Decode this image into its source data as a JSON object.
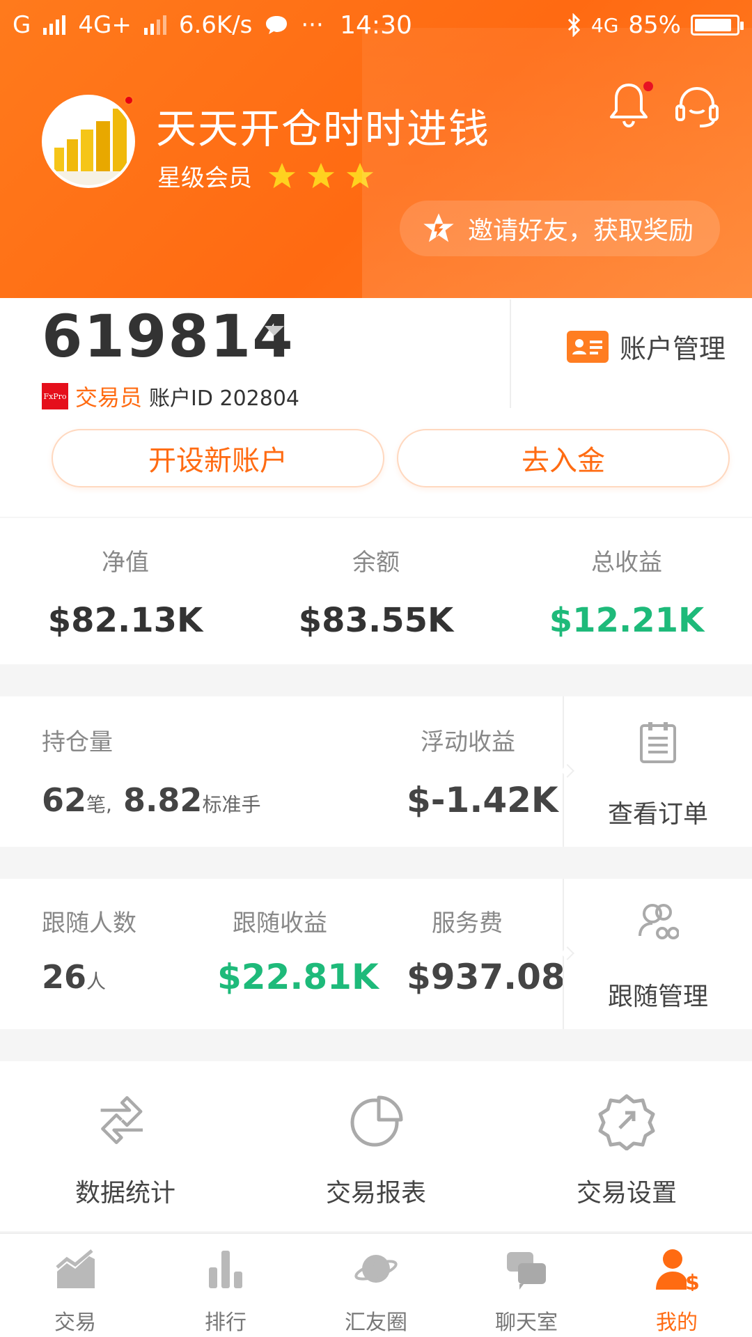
{
  "status_bar": {
    "carrier": "G",
    "network": "4G+",
    "speed": "6.6K/s",
    "time": "14:30",
    "network2": "4G",
    "battery": "85%"
  },
  "profile": {
    "nickname": "天天开仓时时进钱",
    "member_level": "星级会员",
    "stars": 3,
    "invite_text": "邀请好友，获取奖励"
  },
  "account": {
    "number": "619814",
    "broker_logo": "FxPro",
    "role": "交易员",
    "id_label": "账户ID 202804",
    "manage_label": "账户管理",
    "open_new_label": "开设新账户",
    "deposit_label": "去入金"
  },
  "stats": [
    {
      "label": "净值",
      "value": "$82.13K"
    },
    {
      "label": "余额",
      "value": "$83.55K"
    },
    {
      "label": "总收益",
      "value": "$12.21K"
    }
  ],
  "positions": {
    "holding_label": "持仓量",
    "holding_count": "62",
    "holding_count_unit": "笔,",
    "holding_lots": "8.82",
    "holding_lots_unit": "标准手",
    "floating_label": "浮动收益",
    "floating_value": "$-1.42K",
    "view_orders_label": "查看订单"
  },
  "follow": {
    "followers_label": "跟随人数",
    "followers_value": "26",
    "followers_unit": "人",
    "follow_profit_label": "跟随收益",
    "follow_profit_value": "$22.81K",
    "service_fee_label": "服务费",
    "service_fee_value": "$937.08",
    "manage_label": "跟随管理"
  },
  "tools": [
    {
      "label": "数据统计",
      "icon": "transfer-arrows-icon"
    },
    {
      "label": "交易报表",
      "icon": "pie-chart-icon"
    },
    {
      "label": "交易设置",
      "icon": "settings-gear-icon"
    }
  ],
  "tabs": [
    {
      "label": "交易",
      "icon": "trade-chart-icon"
    },
    {
      "label": "排行",
      "icon": "ranking-bars-icon"
    },
    {
      "label": "汇友圈",
      "icon": "planet-icon"
    },
    {
      "label": "聊天室",
      "icon": "chat-bubbles-icon"
    },
    {
      "label": "我的",
      "icon": "user-dollar-icon",
      "active": true
    }
  ],
  "colors": {
    "brand_orange": "#ff6b12",
    "profit_green": "#1eba7a",
    "notification_red": "#e60012"
  }
}
